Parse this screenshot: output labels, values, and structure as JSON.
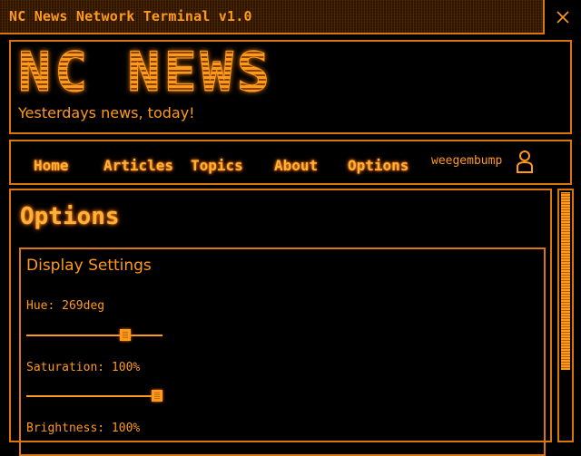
{
  "window": {
    "title": "NC News Network Terminal v1.0",
    "close_icon": "close-icon"
  },
  "header": {
    "logo": "NC NEWS",
    "tagline": "Yesterdays news, today!"
  },
  "nav": {
    "items": [
      {
        "label": "Home"
      },
      {
        "label": "Articles"
      },
      {
        "label": "Topics"
      },
      {
        "label": "About"
      },
      {
        "label": "Options"
      }
    ],
    "username": "weegembump",
    "user_icon": "user-icon"
  },
  "main": {
    "title": "Options",
    "display_settings": {
      "title": "Display Settings",
      "hue": {
        "label": "Hue: 269deg",
        "value": 269,
        "max": 360
      },
      "saturation": {
        "label": "Saturation: 100%",
        "value": 100,
        "max": 100
      },
      "brightness": {
        "label": "Brightness: 100%",
        "value": 100,
        "max": 100
      }
    }
  },
  "colors": {
    "accent": "#ff9a1a",
    "border": "#d9760c",
    "background": "#000000"
  }
}
